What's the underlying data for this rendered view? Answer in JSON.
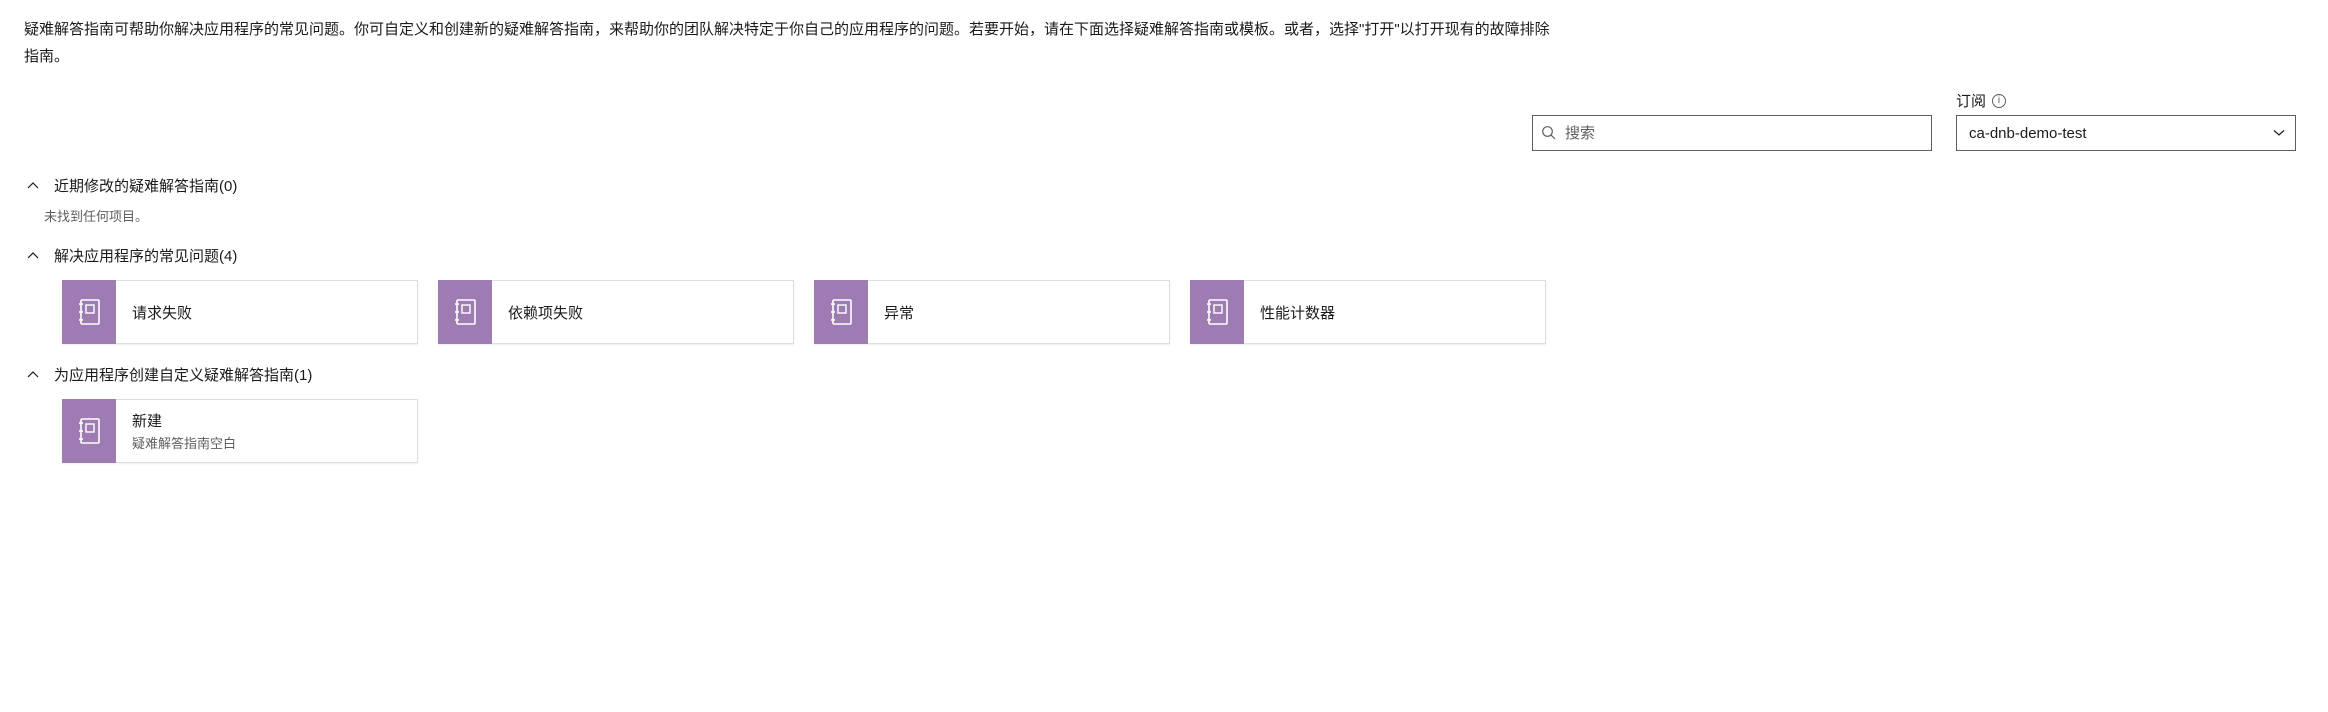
{
  "description": "疑难解答指南可帮助你解决应用程序的常见问题。你可自定义和创建新的疑难解答指南，来帮助你的团队解决特定于你自己的应用程序的问题。若要开始，请在下面选择疑难解答指南或模板。或者，选择\"打开\"以打开现有的故障排除指南。",
  "search": {
    "placeholder": "搜索"
  },
  "subscription": {
    "label": "订阅",
    "selected": "ca-dnb-demo-test"
  },
  "sections": [
    {
      "title": "近期修改的疑难解答指南(0)",
      "empty_text": "未找到任何项目。",
      "cards": []
    },
    {
      "title": "解决应用程序的常见问题(4)",
      "cards": [
        {
          "title": "请求失败"
        },
        {
          "title": "依赖项失败"
        },
        {
          "title": "异常"
        },
        {
          "title": "性能计数器"
        }
      ]
    },
    {
      "title": "为应用程序创建自定义疑难解答指南(1)",
      "cards": [
        {
          "title": "新建",
          "subtitle": "疑难解答指南空白"
        }
      ]
    }
  ]
}
